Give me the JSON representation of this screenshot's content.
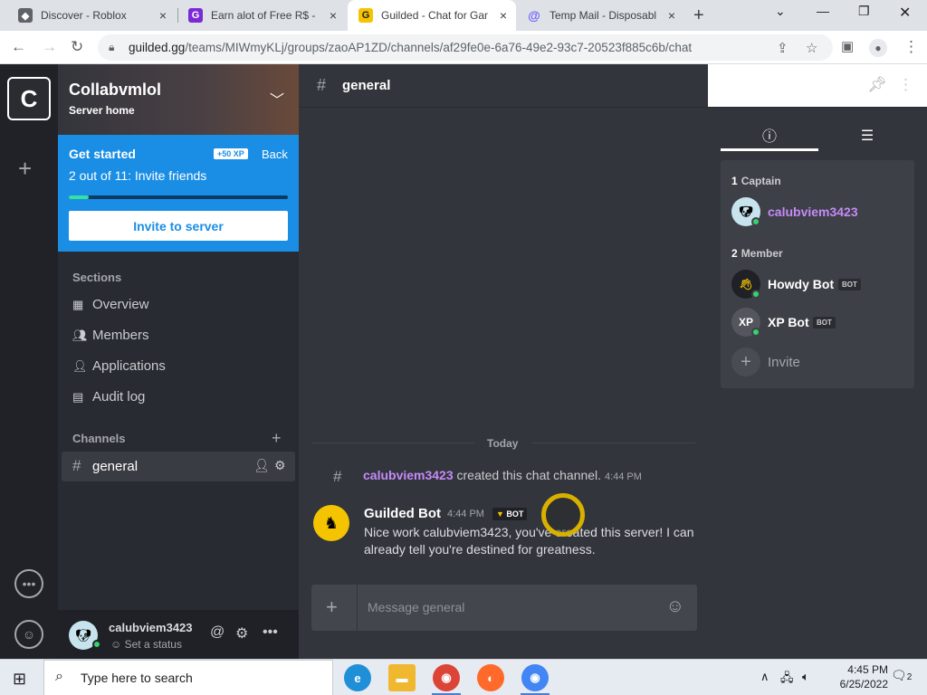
{
  "browser": {
    "tabs": [
      {
        "title": "Discover - Roblox",
        "close": "×"
      },
      {
        "title": "Earn alot of Free R$ - G",
        "close": "×"
      },
      {
        "title": "Guilded - Chat for Gam",
        "close": "×"
      },
      {
        "title": "Temp Mail - Disposable",
        "close": "×"
      }
    ],
    "new_tab": "+",
    "url_host": "guilded.gg",
    "url_path": "/teams/MIWmyKLj/groups/zaoAP1ZD/channels/af29fe0e-6a76-49e2-93c7-20523f885c6b/chat"
  },
  "server": {
    "initial": "C",
    "name": "Collabvmlol",
    "subtitle": "Server home"
  },
  "get_started": {
    "title": "Get started",
    "xp": "+50 XP",
    "back": "Back",
    "progress_text": "2 out of 11: Invite friends",
    "progress": 0.09,
    "invite_button": "Invite to server"
  },
  "sections": {
    "heading": "Sections",
    "items": [
      "Overview",
      "Members",
      "Applications",
      "Audit log"
    ]
  },
  "channels": {
    "heading": "Channels",
    "items": [
      {
        "name": "general"
      }
    ]
  },
  "user": {
    "name": "calubviem3423",
    "status": "Set a status"
  },
  "chat": {
    "channel_name": "general",
    "date_divider": "Today",
    "system_message": {
      "user": "calubviem3423",
      "text": "created this chat channel.",
      "time": "4:44 PM"
    },
    "bot_message": {
      "author": "Guilded Bot",
      "time": "4:44 PM",
      "badge": "BOT",
      "text": "Nice work calubviem3423, you've created this server! I can already tell you're destined for greatness."
    },
    "composer_placeholder": "Message general"
  },
  "members_panel": {
    "groups": [
      {
        "count": "1",
        "label": "Captain",
        "members": [
          {
            "name": "calubviem3423",
            "bot": false,
            "color": "#c58af9"
          }
        ]
      },
      {
        "count": "2",
        "label": "Member",
        "members": [
          {
            "name": "Howdy Bot",
            "bot": true,
            "badge": "BOT",
            "color": "#ffffff"
          },
          {
            "name": "XP Bot",
            "bot": true,
            "badge": "BOT",
            "color": "#ffffff"
          }
        ]
      }
    ],
    "invite": "Invite"
  },
  "taskbar": {
    "search_placeholder": "Type here to search",
    "time": "4:45 PM",
    "date": "6/25/2022",
    "notifications": "2"
  },
  "colors": {
    "accent_blue": "#1a8ee5",
    "guilded_yellow": "#f5c400",
    "captain_purple": "#c58af9",
    "online_green": "#36d26d"
  }
}
